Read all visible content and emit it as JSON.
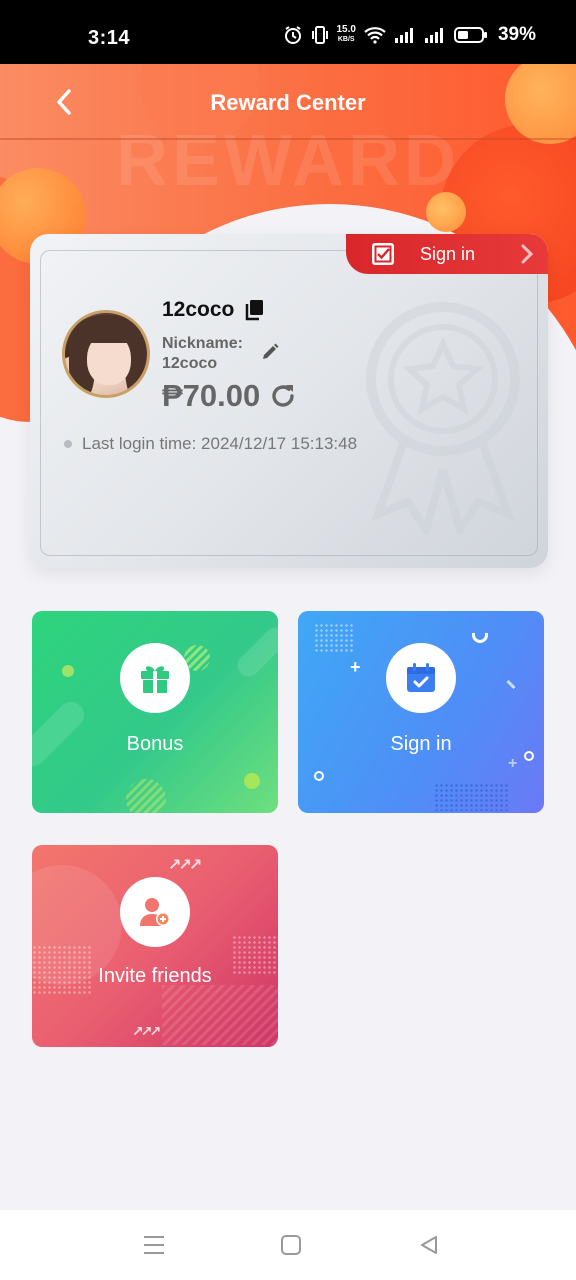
{
  "status_bar": {
    "time": "3:14",
    "speed_value": "15.0",
    "speed_unit": "KB/S",
    "battery_percent": "39%"
  },
  "header": {
    "title": "Reward Center",
    "watermark": "REWARD"
  },
  "profile": {
    "sign_in_tab_label": "Sign in",
    "username": "12coco",
    "nickname_label": "Nickname:",
    "nickname_value": "12coco",
    "balance": "₱70.00",
    "last_login": "Last login time: 2024/12/17 15:13:48"
  },
  "tiles": {
    "bonus": {
      "label": "Bonus"
    },
    "sign_in": {
      "label": "Sign in"
    },
    "invite": {
      "label": "Invite friends"
    }
  },
  "colors": {
    "header_orange": "#fb6e42",
    "sign_in_red": "#d8262a",
    "bonus_green": "#2ed47d",
    "sign_in_blue": "#4f8ef7",
    "invite_pink": "#ea5f71"
  }
}
